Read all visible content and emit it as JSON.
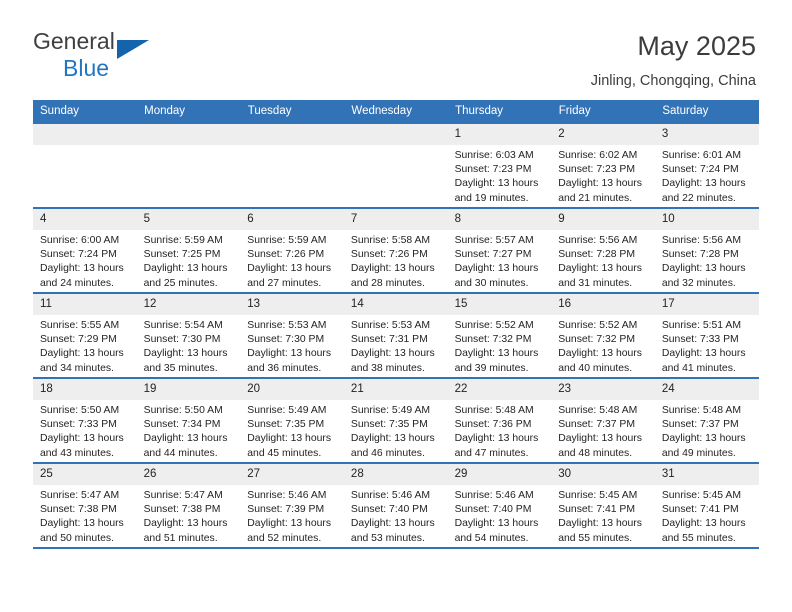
{
  "brand": {
    "name_top": "General",
    "name_bottom": "Blue",
    "triangle_color": "#1464ad",
    "blue_color": "#1f77c4"
  },
  "header": {
    "title": "May 2025",
    "subtitle": "Jinling, Chongqing, China"
  },
  "theme": {
    "header_bar": "#3273b8",
    "date_band": "#eeeeee",
    "text": "#231f20"
  },
  "weekday_headers": [
    "Sunday",
    "Monday",
    "Tuesday",
    "Wednesday",
    "Thursday",
    "Friday",
    "Saturday"
  ],
  "labels": {
    "sunrise_prefix": "Sunrise:",
    "sunset_prefix": "Sunset:",
    "daylight_prefix": "Daylight:"
  },
  "weeks": [
    [
      {
        "day": "",
        "empty": true
      },
      {
        "day": "",
        "empty": true
      },
      {
        "day": "",
        "empty": true
      },
      {
        "day": "",
        "empty": true
      },
      {
        "day": "1",
        "sunrise": "Sunrise: 6:03 AM",
        "sunset": "Sunset: 7:23 PM",
        "daylight_line1": "Daylight: 13 hours",
        "daylight_line2": "and 19 minutes."
      },
      {
        "day": "2",
        "sunrise": "Sunrise: 6:02 AM",
        "sunset": "Sunset: 7:23 PM",
        "daylight_line1": "Daylight: 13 hours",
        "daylight_line2": "and 21 minutes."
      },
      {
        "day": "3",
        "sunrise": "Sunrise: 6:01 AM",
        "sunset": "Sunset: 7:24 PM",
        "daylight_line1": "Daylight: 13 hours",
        "daylight_line2": "and 22 minutes."
      }
    ],
    [
      {
        "day": "4",
        "sunrise": "Sunrise: 6:00 AM",
        "sunset": "Sunset: 7:24 PM",
        "daylight_line1": "Daylight: 13 hours",
        "daylight_line2": "and 24 minutes."
      },
      {
        "day": "5",
        "sunrise": "Sunrise: 5:59 AM",
        "sunset": "Sunset: 7:25 PM",
        "daylight_line1": "Daylight: 13 hours",
        "daylight_line2": "and 25 minutes."
      },
      {
        "day": "6",
        "sunrise": "Sunrise: 5:59 AM",
        "sunset": "Sunset: 7:26 PM",
        "daylight_line1": "Daylight: 13 hours",
        "daylight_line2": "and 27 minutes."
      },
      {
        "day": "7",
        "sunrise": "Sunrise: 5:58 AM",
        "sunset": "Sunset: 7:26 PM",
        "daylight_line1": "Daylight: 13 hours",
        "daylight_line2": "and 28 minutes."
      },
      {
        "day": "8",
        "sunrise": "Sunrise: 5:57 AM",
        "sunset": "Sunset: 7:27 PM",
        "daylight_line1": "Daylight: 13 hours",
        "daylight_line2": "and 30 minutes."
      },
      {
        "day": "9",
        "sunrise": "Sunrise: 5:56 AM",
        "sunset": "Sunset: 7:28 PM",
        "daylight_line1": "Daylight: 13 hours",
        "daylight_line2": "and 31 minutes."
      },
      {
        "day": "10",
        "sunrise": "Sunrise: 5:56 AM",
        "sunset": "Sunset: 7:28 PM",
        "daylight_line1": "Daylight: 13 hours",
        "daylight_line2": "and 32 minutes."
      }
    ],
    [
      {
        "day": "11",
        "sunrise": "Sunrise: 5:55 AM",
        "sunset": "Sunset: 7:29 PM",
        "daylight_line1": "Daylight: 13 hours",
        "daylight_line2": "and 34 minutes."
      },
      {
        "day": "12",
        "sunrise": "Sunrise: 5:54 AM",
        "sunset": "Sunset: 7:30 PM",
        "daylight_line1": "Daylight: 13 hours",
        "daylight_line2": "and 35 minutes."
      },
      {
        "day": "13",
        "sunrise": "Sunrise: 5:53 AM",
        "sunset": "Sunset: 7:30 PM",
        "daylight_line1": "Daylight: 13 hours",
        "daylight_line2": "and 36 minutes."
      },
      {
        "day": "14",
        "sunrise": "Sunrise: 5:53 AM",
        "sunset": "Sunset: 7:31 PM",
        "daylight_line1": "Daylight: 13 hours",
        "daylight_line2": "and 38 minutes."
      },
      {
        "day": "15",
        "sunrise": "Sunrise: 5:52 AM",
        "sunset": "Sunset: 7:32 PM",
        "daylight_line1": "Daylight: 13 hours",
        "daylight_line2": "and 39 minutes."
      },
      {
        "day": "16",
        "sunrise": "Sunrise: 5:52 AM",
        "sunset": "Sunset: 7:32 PM",
        "daylight_line1": "Daylight: 13 hours",
        "daylight_line2": "and 40 minutes."
      },
      {
        "day": "17",
        "sunrise": "Sunrise: 5:51 AM",
        "sunset": "Sunset: 7:33 PM",
        "daylight_line1": "Daylight: 13 hours",
        "daylight_line2": "and 41 minutes."
      }
    ],
    [
      {
        "day": "18",
        "sunrise": "Sunrise: 5:50 AM",
        "sunset": "Sunset: 7:33 PM",
        "daylight_line1": "Daylight: 13 hours",
        "daylight_line2": "and 43 minutes."
      },
      {
        "day": "19",
        "sunrise": "Sunrise: 5:50 AM",
        "sunset": "Sunset: 7:34 PM",
        "daylight_line1": "Daylight: 13 hours",
        "daylight_line2": "and 44 minutes."
      },
      {
        "day": "20",
        "sunrise": "Sunrise: 5:49 AM",
        "sunset": "Sunset: 7:35 PM",
        "daylight_line1": "Daylight: 13 hours",
        "daylight_line2": "and 45 minutes."
      },
      {
        "day": "21",
        "sunrise": "Sunrise: 5:49 AM",
        "sunset": "Sunset: 7:35 PM",
        "daylight_line1": "Daylight: 13 hours",
        "daylight_line2": "and 46 minutes."
      },
      {
        "day": "22",
        "sunrise": "Sunrise: 5:48 AM",
        "sunset": "Sunset: 7:36 PM",
        "daylight_line1": "Daylight: 13 hours",
        "daylight_line2": "and 47 minutes."
      },
      {
        "day": "23",
        "sunrise": "Sunrise: 5:48 AM",
        "sunset": "Sunset: 7:37 PM",
        "daylight_line1": "Daylight: 13 hours",
        "daylight_line2": "and 48 minutes."
      },
      {
        "day": "24",
        "sunrise": "Sunrise: 5:48 AM",
        "sunset": "Sunset: 7:37 PM",
        "daylight_line1": "Daylight: 13 hours",
        "daylight_line2": "and 49 minutes."
      }
    ],
    [
      {
        "day": "25",
        "sunrise": "Sunrise: 5:47 AM",
        "sunset": "Sunset: 7:38 PM",
        "daylight_line1": "Daylight: 13 hours",
        "daylight_line2": "and 50 minutes."
      },
      {
        "day": "26",
        "sunrise": "Sunrise: 5:47 AM",
        "sunset": "Sunset: 7:38 PM",
        "daylight_line1": "Daylight: 13 hours",
        "daylight_line2": "and 51 minutes."
      },
      {
        "day": "27",
        "sunrise": "Sunrise: 5:46 AM",
        "sunset": "Sunset: 7:39 PM",
        "daylight_line1": "Daylight: 13 hours",
        "daylight_line2": "and 52 minutes."
      },
      {
        "day": "28",
        "sunrise": "Sunrise: 5:46 AM",
        "sunset": "Sunset: 7:40 PM",
        "daylight_line1": "Daylight: 13 hours",
        "daylight_line2": "and 53 minutes."
      },
      {
        "day": "29",
        "sunrise": "Sunrise: 5:46 AM",
        "sunset": "Sunset: 7:40 PM",
        "daylight_line1": "Daylight: 13 hours",
        "daylight_line2": "and 54 minutes."
      },
      {
        "day": "30",
        "sunrise": "Sunrise: 5:45 AM",
        "sunset": "Sunset: 7:41 PM",
        "daylight_line1": "Daylight: 13 hours",
        "daylight_line2": "and 55 minutes."
      },
      {
        "day": "31",
        "sunrise": "Sunrise: 5:45 AM",
        "sunset": "Sunset: 7:41 PM",
        "daylight_line1": "Daylight: 13 hours",
        "daylight_line2": "and 55 minutes."
      }
    ]
  ]
}
